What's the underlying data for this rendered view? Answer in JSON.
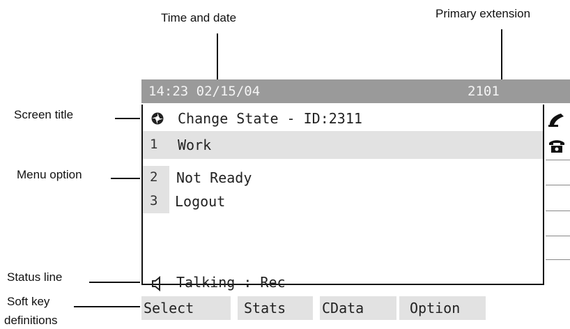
{
  "callouts": {
    "time_date": "Time and date",
    "primary_extension": "Primary extension",
    "screen_title": "Screen title",
    "menu_option": "Menu option",
    "status_line": "Status line",
    "soft_key_line1": "Soft key",
    "soft_key_line2": "definitions"
  },
  "phone": {
    "status_bar": {
      "time_date": "14:23 02/15/04",
      "extension": "2101"
    },
    "title": "Change State - ID:2311",
    "menu": [
      {
        "number": "1",
        "label": "Work"
      },
      {
        "number": "2",
        "label": "Not Ready"
      },
      {
        "number": "3",
        "label": "Logout"
      }
    ],
    "status_line": "Talking : Rec",
    "softkeys": [
      "Select",
      "Stats",
      "CData",
      "Option"
    ]
  },
  "icons": {
    "title": "state-icon",
    "status": "speaker-icon",
    "side": [
      "handset-icon",
      "phone-icon"
    ]
  },
  "colors": {
    "status_bar_bg": "#9a9a9a",
    "highlight_bg": "#e2e2e2"
  }
}
